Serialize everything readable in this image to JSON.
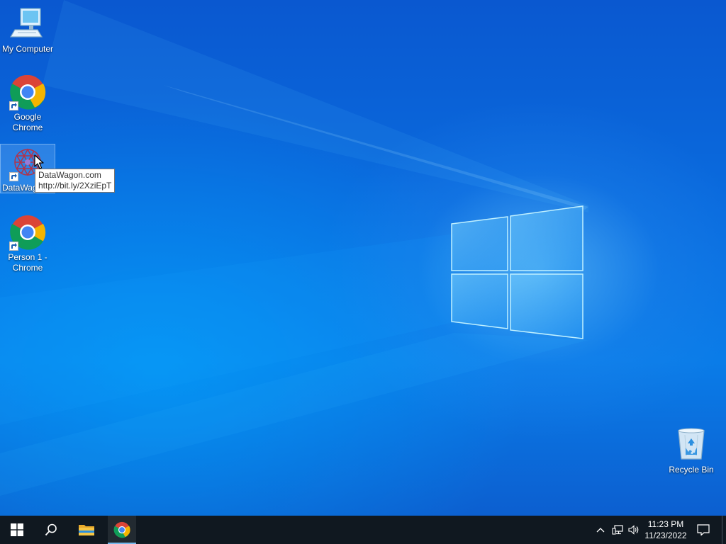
{
  "desktop": {
    "icons": [
      {
        "label": "My Computer",
        "icon": "computer-icon"
      },
      {
        "label": "Google Chrome",
        "icon": "chrome-icon"
      },
      {
        "label": "DataWagon",
        "icon": "datawagon-icon"
      },
      {
        "label": "Person 1 - Chrome",
        "icon": "chrome-icon"
      },
      {
        "label": "Recycle Bin",
        "icon": "recycle-bin-icon"
      }
    ],
    "tooltip": {
      "line1": "DataWagon.com",
      "line2": "http://bit.ly/2XziEpT"
    }
  },
  "taskbar": {
    "start": "windows-start-icon",
    "search": "search-icon",
    "pinned": [
      "file-explorer-icon",
      "chrome-icon"
    ],
    "tray": {
      "icons": [
        "chevron-up-icon",
        "network-icon",
        "volume-icon"
      ],
      "time": "11:23 PM",
      "date": "11/23/2022",
      "notifications": "notification-icon"
    }
  },
  "colors": {
    "taskbar": "#101820",
    "accent": "#76b9ed"
  }
}
